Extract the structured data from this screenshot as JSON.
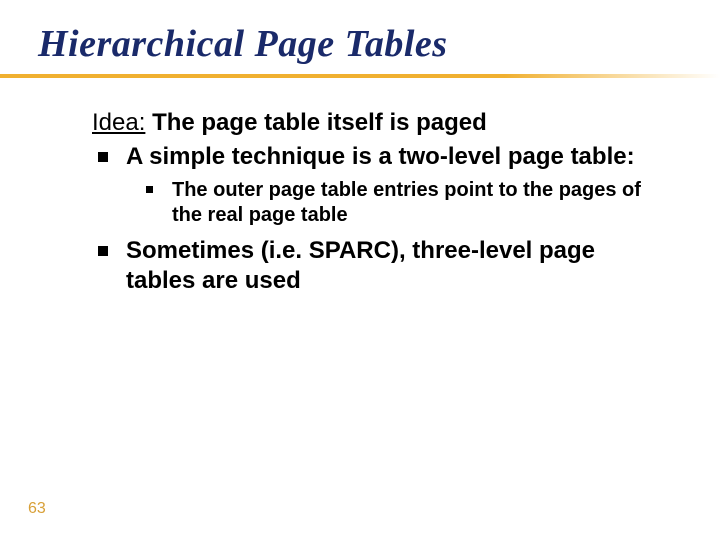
{
  "title": "Hierarchical Page Tables",
  "idea": {
    "label": "Idea:",
    "text": "The page table itself is paged"
  },
  "bullets": {
    "b1": "A simple technique is a two-level page table:",
    "b1_sub1": "The outer page table entries point to the pages of the real page table",
    "b2": "Sometimes (i.e. SPARC), three-level page tables are used"
  },
  "page_number": "63"
}
